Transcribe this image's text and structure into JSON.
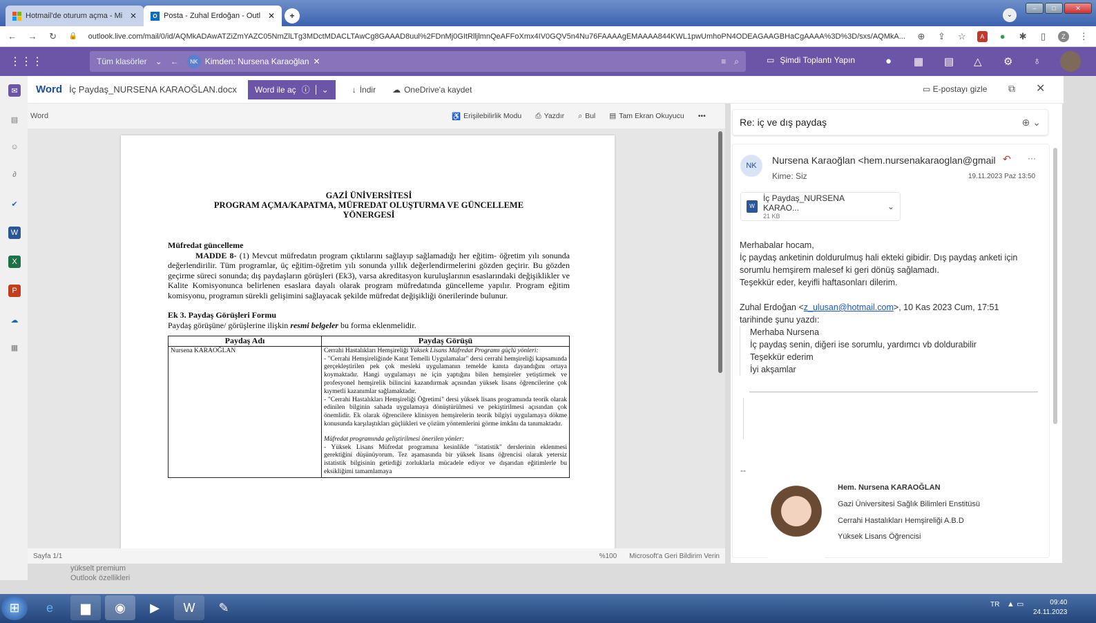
{
  "browser": {
    "tabs": [
      {
        "label": "Hotmail'de oturum açma - Micro"
      },
      {
        "label": "Posta - Zuhal Erdoğan - Outlook"
      }
    ],
    "url": "outlook.live.com/mail/0/id/AQMkADAwATZiZmYAZC05NmZlLTg3MDctMDACLTAwCg8GAAAD8uul%2FDnMj0GItRlljlmnQeAFFoXmx4IV0GQV5n4Nu76FAAAAgEMAAAA844KWL1pwUmhoPN4ODEAGAAGBHaCgAAAA%3D%3D/sxs/AQMkA..."
  },
  "outlook": {
    "folder_filter": "Tüm klasörler",
    "from_filter": "Kimden: Nursena Karaoğlan",
    "from_initials": "NK",
    "meet_label": "Şimdi Toplantı Yapın"
  },
  "viewer": {
    "app": "Word",
    "file_name": "İç Paydaş_NURSENA KARAOĞLAN.docx",
    "open_in_word": "Word ile aç",
    "download": "İndir",
    "save_onedrive": "OneDrive'a kaydet",
    "hide_email": "E-postayı gizle"
  },
  "word_toolbar": {
    "label": "Word",
    "accessibility": "Erişilebilirlik Modu",
    "print": "Yazdır",
    "find": "Bul",
    "reader": "Tam Ekran Okuyucu"
  },
  "document": {
    "title1": "GAZİ ÜNİVERSİTESİ",
    "title2": "PROGRAM AÇMA/KAPATMA, MÜFREDAT OLUŞTURMA VE GÜNCELLEME",
    "title3": "YÖNERGESİ",
    "heading": "Müfredat güncelleme",
    "madde": "MADDE 8-",
    "madde_text": " (1) Mevcut müfredatın program çıktılarını sağlayıp sağlamadığı her eğitim- öğretim yılı sonunda değerlendirilir. Tüm programlar, üç eğitim-öğretim yılı sonunda yıllık değerlendirmelerini gözden geçirir. Bu gözden geçirme süreci sonunda; dış paydaşların görüşleri (Ek3), varsa akreditasyon kuruluşlarının esaslarındaki değişiklikler ve Kalite Komisyonunca belirlenen esaslara dayalı olarak program müfredatında güncelleme yapılır. Program eğitim komisyonu, programın sürekli gelişimini sağlayacak şekilde müfredat değişikliği önerilerinde bulunur.",
    "ek_heading": "Ek 3.  Paydaş Görüşleri Formu",
    "ek_line_a": "Paydaş görüşüne/ görüşlerine ilişkin ",
    "ek_line_b": "resmi belgeler",
    "ek_line_c": " bu forma eklenmelidir.",
    "col1": "Paydaş Adı",
    "col2": "Paydaş Görüşü",
    "stakeholder": "Nursena KARAOĞLAN",
    "op_lead_a": "Cerrahi Hastalıkları Hemşireliği ",
    "op_lead_b": "Yüksek Lisans Müfredat Programı güçlü yönleri:",
    "op_p1": "- \"Cerrahi Hemşireliğinde Kanıt Temelli Uygulamalar\" dersi cerrahi hemşireliği kapsamında gerçekleştirilen pek çok mesleki uygulamanın temelde kanıta dayandığını ortaya koymaktadır. Hangi uygulamayı ne için yaptığını bilen hemşireler yetiştirmek ve profesyonel hemşirelik bilincini kazandırmak açısından yüksek lisans öğrencilerine çok kıymetli kazanımlar sağlamaktadır.",
    "op_p2": "- \"Cerrahi Hastalıkları Hemşireliği Öğretimi\" dersi yüksek lisans programında teorik olarak edinilen bilginin sahada uygulamaya dönüştürülmesi ve pekiştirilmesi açısından çok önemlidir. Ek olarak öğrencilere klinisyen hemşirelerin teorik bilgiyi uygulamaya dökme konusunda karşılaştıkları güçlükleri ve çözüm yöntemlerini görme imkânı da tanımaktadır.",
    "op_sub": "Müfredat programında geliştirilmesi önerilen yönler:",
    "op_p3": "- Yüksek Lisans Müfredat programına kesinlikle \"istatistik\" derslerinin eklenmesi gerektiğini düşünüyorum. Tez aşamasında bir yüksek lisans öğrencisi olarak yetersiz istatistik bilgisinin getirdiği zorluklarla mücadele ediyor ve dışarıdan eğitimlerle bu eksikliğimi tamamlamaya",
    "status_page": "Sayfa 1/1",
    "zoom": "%100",
    "feedback": "Microsoft'a Geri Bildirim Verin"
  },
  "mail": {
    "subject": "Re: iç ve dış paydaş",
    "sender_initials": "NK",
    "sender": "Nursena Karaoğlan <hem.nursenakaraoglan@gmail",
    "to": "Kime:  Siz",
    "date": "19.11.2023 Paz 13:50",
    "attachment_name": "İç Paydaş_NURSENA KARAO...",
    "attachment_size": "21 KB",
    "body1": "Merhabalar hocam,",
    "body2": "İç paydaş anketinin doldurulmuş hali ekteki gibidir. Dış paydaş anketi için sorumlu hemşirem malesef ki geri dönüş sağlamadı.",
    "body3": "Teşekkür eder, keyifli haftasonları dilerim.",
    "quote_a": "Zuhal Erdoğan <",
    "quote_email": "z_ulusan@hotmail.com",
    "quote_b": ">, 10 Kas 2023 Cum, 17:51",
    "quote_c": "tarihinde şunu yazdı:",
    "q1": "Merhaba Nursena",
    "q2": "İç paydaş senin, diğeri ise sorumlu, yardımcı vb doldurabilir",
    "q3": "Teşekkür ederim",
    "q4": "İyi akşamlar",
    "dashes": "--",
    "sig_name": "Hem. Nursena KARAOĞLAN",
    "sig_l1": "Gazi Üniversitesi Sağlık Bilimleri Enstitüsü",
    "sig_l2": "Cerrahi Hastalıkları Hemşireliği A.B.D",
    "sig_l3": "Yüksek Lisans Öğrencisi"
  },
  "promo": {
    "l1": "yükselt premium",
    "l2": "Outlook özellikleri"
  },
  "taskbar": {
    "lang": "TR",
    "time": "09:40",
    "date": "24.11.2023"
  }
}
